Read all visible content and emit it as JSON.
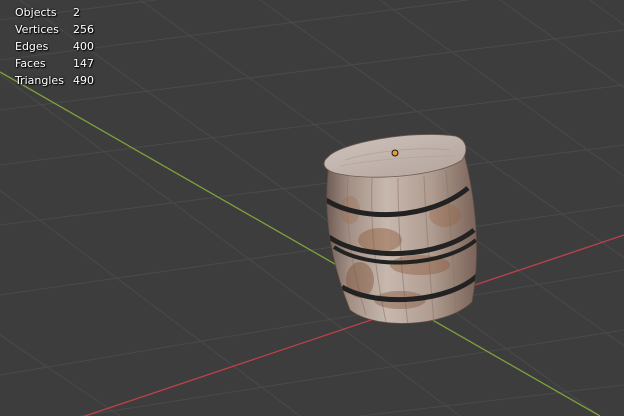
{
  "viewport": {
    "background": "#3d3d3d",
    "grid_color": "#4a4a4a",
    "x_axis_color": "#c0404a",
    "y_axis_color": "#7da23a",
    "origin_color": "#e69a34"
  },
  "stats": [
    {
      "label": "Objects",
      "value": "2"
    },
    {
      "label": "Vertices",
      "value": "256"
    },
    {
      "label": "Edges",
      "value": "400"
    },
    {
      "label": "Faces",
      "value": "147"
    },
    {
      "label": "Triangles",
      "value": "490"
    }
  ],
  "object": {
    "icon": "wooden-barrel-mesh",
    "wood_color": "#b9a79c",
    "hoop_color": "#222222"
  }
}
